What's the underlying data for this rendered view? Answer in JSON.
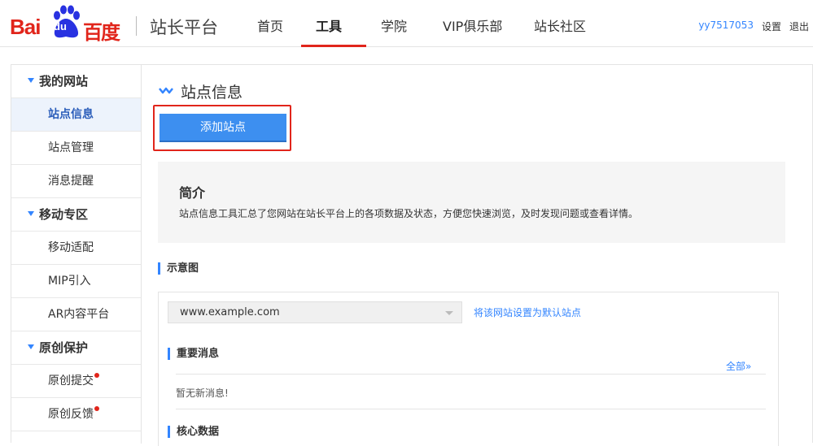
{
  "header": {
    "logo": {
      "latin": "Bai",
      "du": "du",
      "cn": "百度"
    },
    "product_title": "站长平台",
    "nav": [
      {
        "label": "首页",
        "active": false
      },
      {
        "label": "工具",
        "active": true
      },
      {
        "label": "学院",
        "active": false
      },
      {
        "label": "VIP俱乐部",
        "active": false
      },
      {
        "label": "站长社区",
        "active": false
      }
    ],
    "username": "yy7517053",
    "settings_label": "设置",
    "logout_label": "退出"
  },
  "sidebar": {
    "groups": [
      {
        "label": "我的网站",
        "items": [
          {
            "label": "站点信息",
            "active": true,
            "badge": false
          },
          {
            "label": "站点管理",
            "active": false,
            "badge": false
          },
          {
            "label": "消息提醒",
            "active": false,
            "badge": false
          }
        ]
      },
      {
        "label": "移动专区",
        "items": [
          {
            "label": "移动适配",
            "active": false,
            "badge": false
          },
          {
            "label": "MIP引入",
            "active": false,
            "badge": false
          },
          {
            "label": "AR内容平台",
            "active": false,
            "badge": false
          }
        ]
      },
      {
        "label": "原创保护",
        "items": [
          {
            "label": "原创提交",
            "active": false,
            "badge": true
          },
          {
            "label": "原创反馈",
            "active": false,
            "badge": true
          }
        ]
      }
    ]
  },
  "main": {
    "title": "站点信息",
    "add_site_button": "添加站点",
    "intro": {
      "title": "简介",
      "text": "站点信息工具汇总了您网站在站长平台上的各项数据及状态，方便您快速浏览，及时发现问题或查看详情。"
    },
    "diagram_label": "示意图",
    "site_select_value": "www.example.com",
    "set_default_link": "将该网站设置为默认站点",
    "important_news_label": "重要消息",
    "all_link": "全部»",
    "no_news_text": "暂无新消息!",
    "core_data_label": "核心数据"
  },
  "colors": {
    "brand_red": "#e1251b",
    "link_blue": "#3385ff",
    "button_blue": "#3d8ff0",
    "sidebar_active_bg": "#edf3fc"
  }
}
